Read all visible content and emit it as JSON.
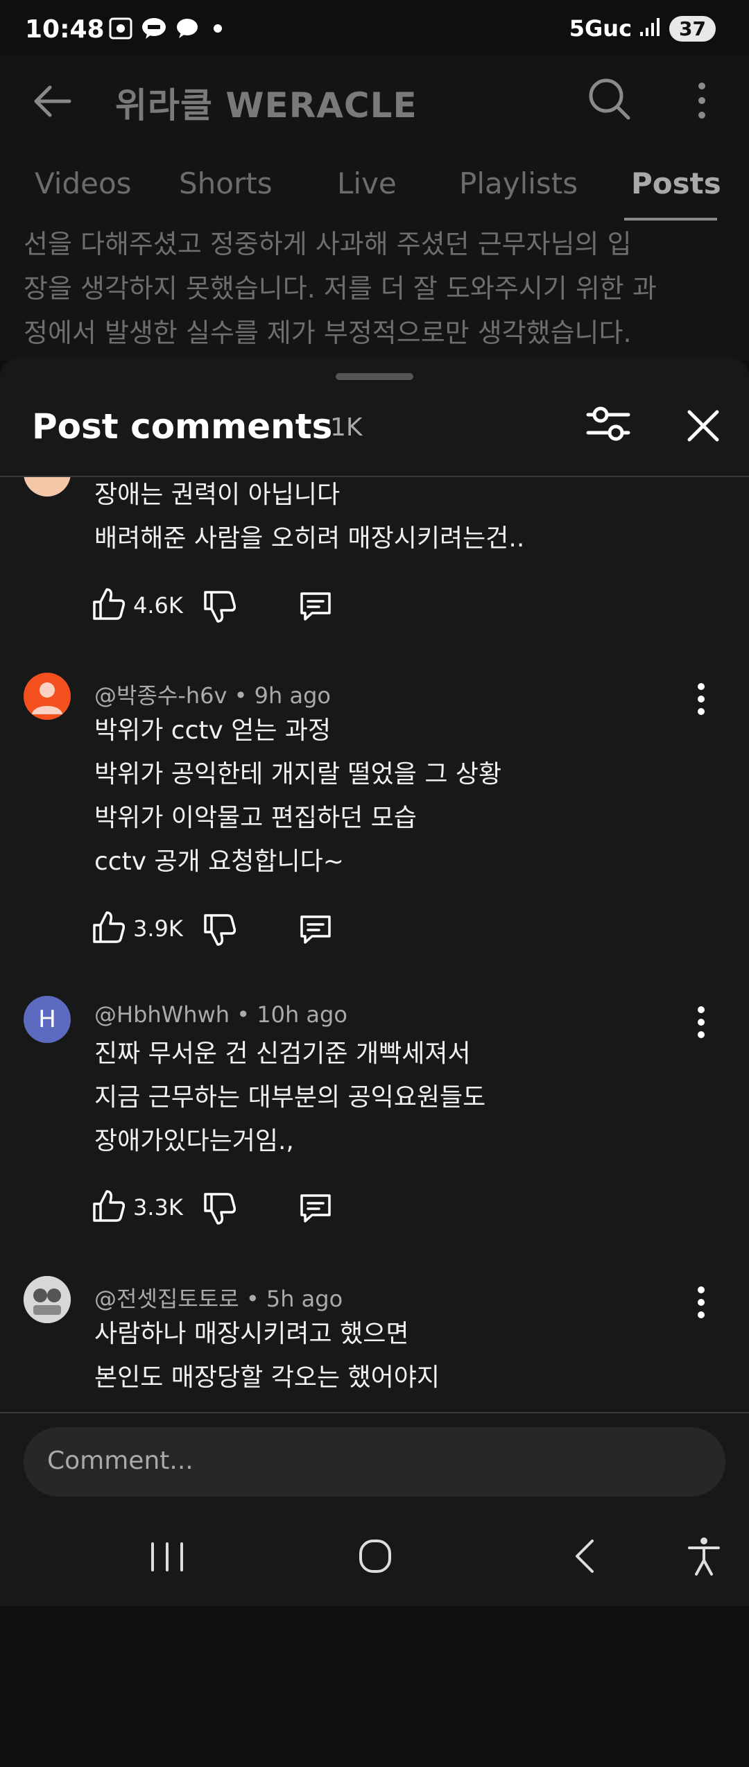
{
  "status_bar": {
    "time": "10:48",
    "network": "5Guc",
    "battery": "37",
    "icons": [
      "screenshot-icon",
      "talk-icon",
      "chat-bubble-icon",
      "notification-dot",
      "signal-icon"
    ]
  },
  "channel": {
    "title": "위라클 WERACLE",
    "tabs": [
      {
        "label": "Videos"
      },
      {
        "label": "Shorts"
      },
      {
        "label": "Live"
      },
      {
        "label": "Playlists"
      },
      {
        "label": "Posts",
        "active": true
      }
    ],
    "post_lines": [
      "선을 다해주셨고 정중하게 사과해 주셨던 근무자님의 입",
      "장을 생각하지 못했습니다. 저를 더 잘 도와주시기 위한 과",
      "정에서 발생한 실수를 제가 부정적으로만 생각했습니다."
    ]
  },
  "sheet": {
    "title": "Post comments",
    "count": "1K"
  },
  "comments": [
    {
      "author": "",
      "time": "",
      "lines": [
        "장애는 권력이 아닙니다",
        "배려해준 사람을 오히려 매장시키려는건.."
      ],
      "likes": "4.6K"
    },
    {
      "author": "@박종수-h6v",
      "time": "9h ago",
      "lines": [
        "박위가 cctv 얻는 과정",
        "박위가 공익한테 개지랄 떨었을 그 상황",
        "박위가 이악물고 편집하던 모습",
        "cctv 공개 요청합니다~"
      ],
      "likes": "3.9K",
      "avatar_color": "#f4511e"
    },
    {
      "author": "@HbhWhwh",
      "time": "10h ago",
      "lines": [
        "진짜 무서운 건 신검기준 개빡세져서",
        "지금 근무하는 대부분의 공익요원들도",
        "장애가있다는거임.,"
      ],
      "likes": "3.3K",
      "avatar_letter": "H",
      "avatar_color": "#5c6bc0"
    },
    {
      "author": "@전셋집토토로",
      "time": "5h ago",
      "lines": [
        "사람하나 매장시키려고 했으면",
        "본인도 매장당할 각오는 했어야지"
      ],
      "likes": ""
    }
  ],
  "composer": {
    "placeholder": "Comment..."
  },
  "colors": {
    "background": "#0f0f0f",
    "sheet": "#181818",
    "input": "#272727",
    "secondary_text": "#aaaaaa"
  }
}
